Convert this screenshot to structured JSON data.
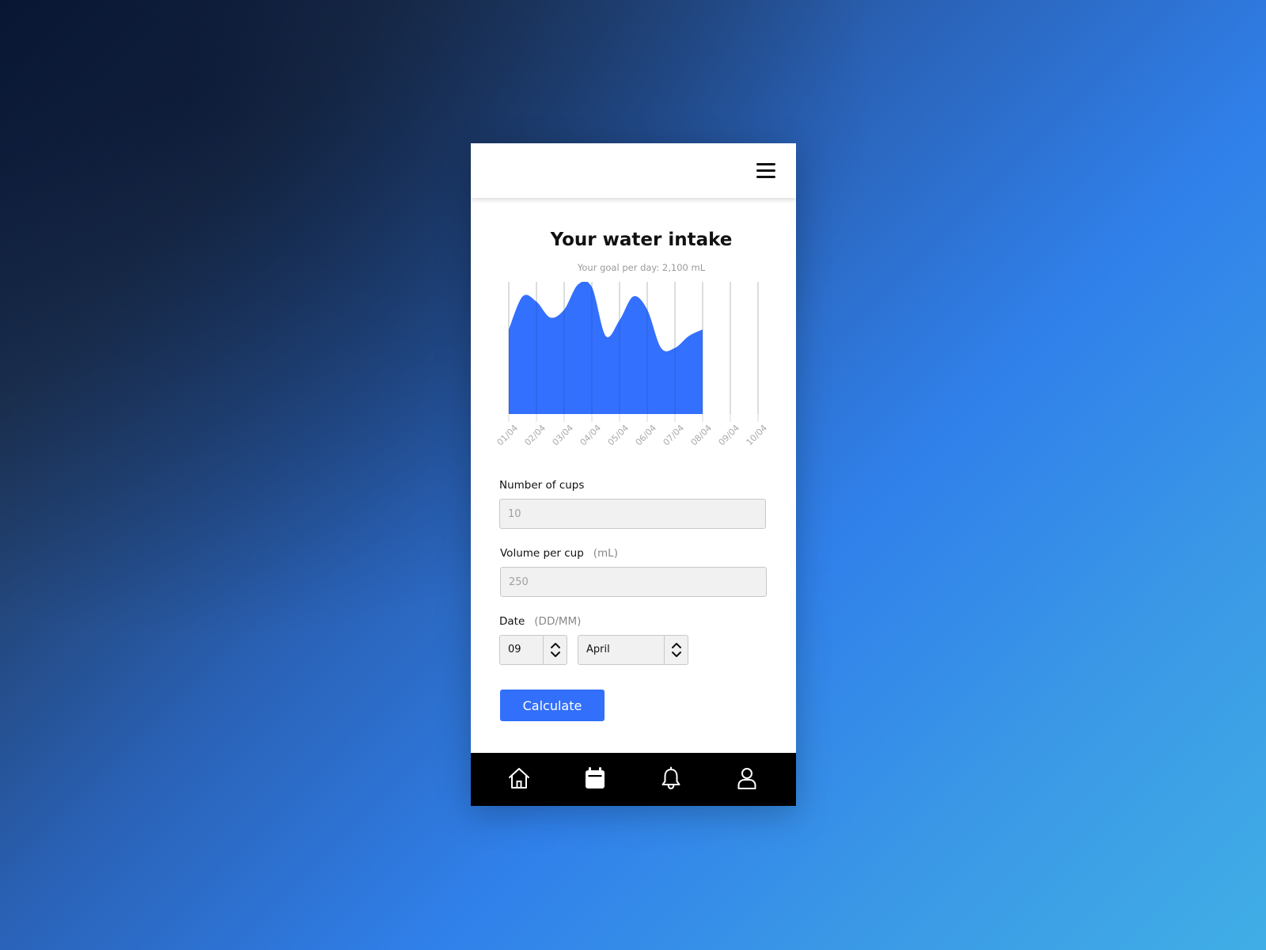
{
  "colors": {
    "accent": "#326ffb",
    "chart_fill": "#3470fe",
    "nav_background": "#000000"
  },
  "header": {
    "menu_icon": "hamburger-icon"
  },
  "intake": {
    "title": "Your water intake",
    "goal_text": "Your goal per day: 2,100 mL"
  },
  "chart_data": {
    "type": "area",
    "title": "Your water intake",
    "categories": [
      "01/04",
      "02/04",
      "03/04",
      "04/04",
      "05/04",
      "06/04",
      "07/04",
      "08/04",
      "09/04",
      "10/04"
    ],
    "ylim": [
      0,
      1
    ],
    "grid": true,
    "legend": "none",
    "series": [
      {
        "x": [
          "01/04",
          "1.5/04",
          "02/04",
          "2.5/04",
          "03/04",
          "3.5/04",
          "04/04",
          "4.5/04",
          "05/04",
          "5.5/04",
          "06/04",
          "6.5/04",
          "07/04",
          "7.5/04",
          "08/04"
        ],
        "values": [
          0.64,
          0.89,
          0.85,
          0.73,
          0.79,
          0.98,
          0.96,
          0.59,
          0.71,
          0.89,
          0.79,
          0.5,
          0.5,
          0.59,
          0.64
        ]
      }
    ]
  },
  "form": {
    "cups": {
      "label": "Number of cups",
      "placeholder": "10"
    },
    "volume": {
      "label": "Volume per cup",
      "unit": "(mL)",
      "placeholder": "250"
    },
    "date": {
      "label": "Date",
      "format": "(DD/MM)",
      "day": "09",
      "month": "April"
    },
    "calculate_label": "Calculate"
  },
  "nav": {
    "items": [
      {
        "icon": "home-icon"
      },
      {
        "icon": "calendar-icon",
        "active": true
      },
      {
        "icon": "bell-icon"
      },
      {
        "icon": "user-icon"
      }
    ]
  }
}
